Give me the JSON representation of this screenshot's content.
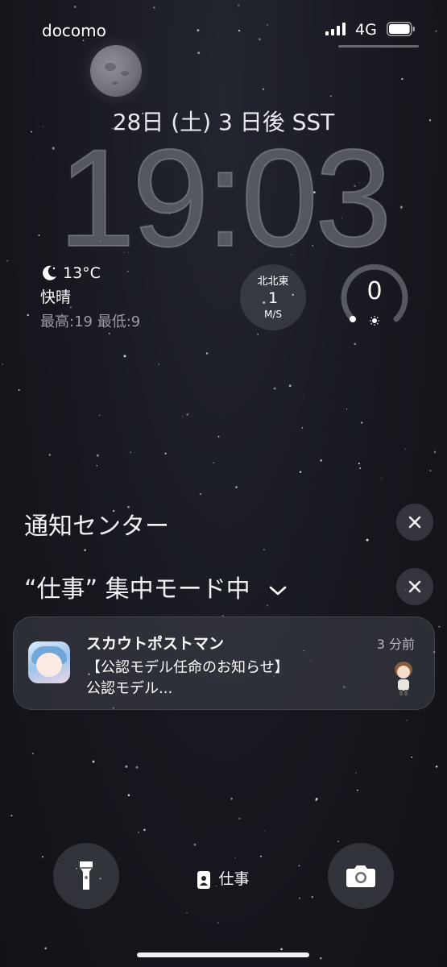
{
  "status_bar": {
    "carrier": "docomo",
    "network": "4G"
  },
  "lock_screen": {
    "date": "28日 (土)  3 日後 SST",
    "time": "19:03"
  },
  "widgets": {
    "weather": {
      "temp": "13°C",
      "condition": "快晴",
      "hilo": "最高:19 最低:9",
      "icon": "moon-icon"
    },
    "wind": {
      "direction": "北北東",
      "speed": "1",
      "unit": "M/S"
    },
    "uv": {
      "value": "0",
      "level": 0
    }
  },
  "notification_center": {
    "title": "通知センター",
    "focus_mode_label": "“仕事” 集中モード中",
    "notification": {
      "app": "スカウトポストマン",
      "time": "3 分前",
      "line1": "【公認モデル任命のお知らせ】",
      "line2": "公認モデル..."
    }
  },
  "bottom": {
    "focus_label": "仕事",
    "left_icon": "flashlight-icon",
    "right_icon": "camera-icon"
  }
}
